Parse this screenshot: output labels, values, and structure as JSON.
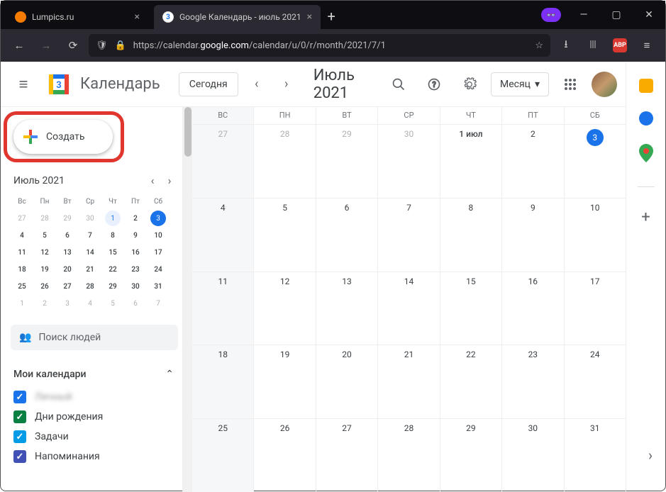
{
  "browser": {
    "tabs": [
      {
        "title": "Lumpics.ru",
        "favicon": "orange"
      },
      {
        "title": "Google Календарь - июль 2021",
        "favicon": "gcal"
      }
    ],
    "url_prefix": "https://calendar.",
    "url_domain": "google.com",
    "url_path": "/calendar/u/0/r/month/2021/7/1"
  },
  "header": {
    "app_name": "Календарь",
    "logo_day": "3",
    "today": "Сегодня",
    "title": "Июль 2021",
    "view": "Месяц"
  },
  "create": {
    "label": "Создать"
  },
  "mini": {
    "title": "Июль 2021",
    "dow": [
      "Вс",
      "Пн",
      "Вт",
      "Ср",
      "Чт",
      "Пт",
      "Сб"
    ],
    "rows": [
      [
        {
          "n": "27",
          "s": "out"
        },
        {
          "n": "28",
          "s": "out"
        },
        {
          "n": "29",
          "s": "out"
        },
        {
          "n": "30",
          "s": "out"
        },
        {
          "n": "1",
          "s": "today"
        },
        {
          "n": "2",
          "s": "cur"
        },
        {
          "n": "3",
          "s": "sel"
        }
      ],
      [
        {
          "n": "4",
          "s": "cur"
        },
        {
          "n": "5",
          "s": "cur"
        },
        {
          "n": "6",
          "s": "cur"
        },
        {
          "n": "7",
          "s": "cur"
        },
        {
          "n": "8",
          "s": "cur"
        },
        {
          "n": "9",
          "s": "cur"
        },
        {
          "n": "10",
          "s": "cur"
        }
      ],
      [
        {
          "n": "11",
          "s": "cur"
        },
        {
          "n": "12",
          "s": "cur"
        },
        {
          "n": "13",
          "s": "cur"
        },
        {
          "n": "14",
          "s": "cur"
        },
        {
          "n": "15",
          "s": "cur"
        },
        {
          "n": "16",
          "s": "cur"
        },
        {
          "n": "17",
          "s": "cur"
        }
      ],
      [
        {
          "n": "18",
          "s": "cur"
        },
        {
          "n": "19",
          "s": "cur"
        },
        {
          "n": "20",
          "s": "cur"
        },
        {
          "n": "21",
          "s": "cur"
        },
        {
          "n": "22",
          "s": "cur"
        },
        {
          "n": "23",
          "s": "cur"
        },
        {
          "n": "24",
          "s": "cur"
        }
      ],
      [
        {
          "n": "25",
          "s": "cur"
        },
        {
          "n": "26",
          "s": "cur"
        },
        {
          "n": "27",
          "s": "cur"
        },
        {
          "n": "28",
          "s": "cur"
        },
        {
          "n": "29",
          "s": "cur"
        },
        {
          "n": "30",
          "s": "cur"
        },
        {
          "n": "31",
          "s": "cur"
        }
      ],
      [
        {
          "n": "1",
          "s": "out"
        },
        {
          "n": "2",
          "s": "out"
        },
        {
          "n": "3",
          "s": "out"
        },
        {
          "n": "4",
          "s": "out"
        },
        {
          "n": "5",
          "s": "out"
        },
        {
          "n": "6",
          "s": "out"
        },
        {
          "n": "7",
          "s": "out"
        }
      ]
    ]
  },
  "search_people": {
    "placeholder": "Поиск людей"
  },
  "my_calendars": {
    "title": "Мои календари",
    "items": [
      {
        "label": "Личный",
        "color": "#1a73e8",
        "blur": true
      },
      {
        "label": "Дни рождения",
        "color": "#0b8043"
      },
      {
        "label": "Задачи",
        "color": "#039be5"
      },
      {
        "label": "Напоминания",
        "color": "#3f51b5"
      }
    ]
  },
  "grid": {
    "dow": [
      "ВС",
      "ПН",
      "ВТ",
      "СР",
      "ЧТ",
      "ПТ",
      "СБ"
    ],
    "rows": [
      [
        {
          "n": "27",
          "s": "out"
        },
        {
          "n": "28",
          "s": "out"
        },
        {
          "n": "29",
          "s": "out"
        },
        {
          "n": "30",
          "s": "out"
        },
        {
          "n": "1 июл",
          "s": "first"
        },
        {
          "n": "2"
        },
        {
          "n": "3",
          "s": "today"
        }
      ],
      [
        {
          "n": "4"
        },
        {
          "n": "5"
        },
        {
          "n": "6"
        },
        {
          "n": "7"
        },
        {
          "n": "8"
        },
        {
          "n": "9"
        },
        {
          "n": "10"
        }
      ],
      [
        {
          "n": "11"
        },
        {
          "n": "12"
        },
        {
          "n": "13"
        },
        {
          "n": "14"
        },
        {
          "n": "15"
        },
        {
          "n": "16"
        },
        {
          "n": "17"
        }
      ],
      [
        {
          "n": "18"
        },
        {
          "n": "19"
        },
        {
          "n": "20"
        },
        {
          "n": "21"
        },
        {
          "n": "22"
        },
        {
          "n": "23"
        },
        {
          "n": "24"
        }
      ],
      [
        {
          "n": "25"
        },
        {
          "n": "26"
        },
        {
          "n": "27"
        },
        {
          "n": "28"
        },
        {
          "n": "29"
        },
        {
          "n": "30"
        },
        {
          "n": "31"
        }
      ]
    ]
  },
  "sidepanel": {
    "keep_color": "#f9ab00",
    "tasks_color": "#1a73e8",
    "maps_colors": [
      "#ea4335",
      "#34a853",
      "#fbbc05",
      "#4285f4"
    ]
  }
}
